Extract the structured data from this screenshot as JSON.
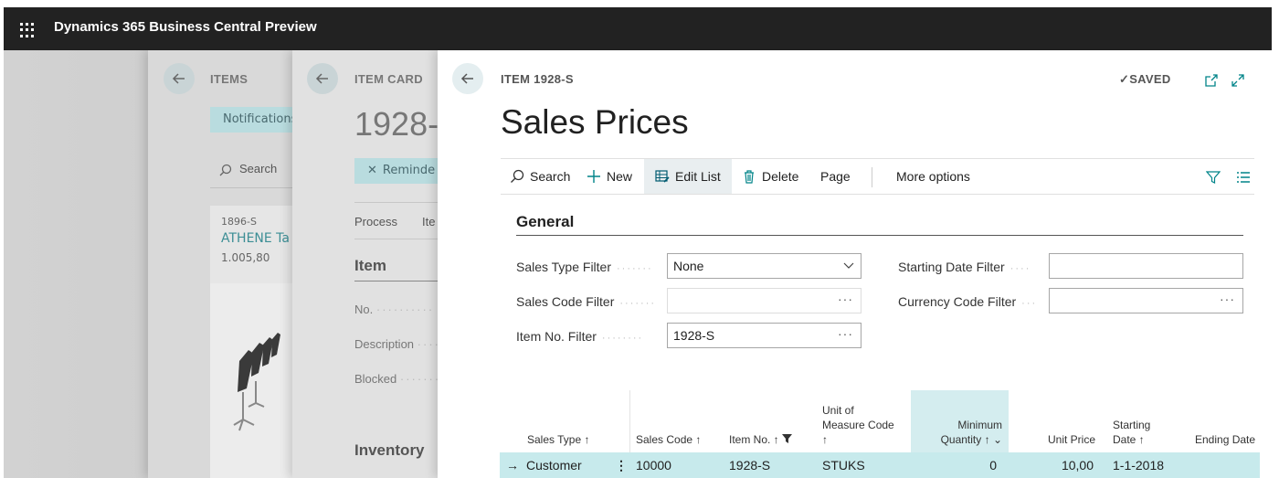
{
  "app": {
    "title": "Dynamics 365 Business Central Preview"
  },
  "panel_items": {
    "crumb": "ITEMS",
    "notifications": "Notifications",
    "search": "Search",
    "card": {
      "no": "1896-S",
      "name": "ATHENE Ta",
      "price": "1.005,80"
    }
  },
  "panel_itemcard": {
    "crumb": "ITEM CARD",
    "title": "1928-",
    "remind": "Reminde",
    "tabs": [
      "Process",
      "Ite"
    ],
    "section": "Item",
    "fields": [
      "No.",
      "Description",
      "Blocked"
    ],
    "section2": "Inventory"
  },
  "panel_main": {
    "crumb": "ITEM 1928-S",
    "saved": "SAVED",
    "title": "Sales Prices",
    "actions": {
      "search": "Search",
      "new": "New",
      "edit_list": "Edit List",
      "delete": "Delete",
      "page": "Page",
      "more": "More options"
    },
    "general": {
      "heading": "General",
      "sales_type_filter": {
        "label": "Sales Type Filter",
        "value": "None"
      },
      "sales_code_filter": {
        "label": "Sales Code Filter",
        "value": ""
      },
      "item_no_filter": {
        "label": "Item No. Filter",
        "value": "1928-S"
      },
      "starting_date_filter": {
        "label": "Starting Date Filter",
        "value": ""
      },
      "currency_code_filter": {
        "label": "Currency Code Filter",
        "value": ""
      }
    },
    "grid": {
      "columns": {
        "sales_type": "Sales Type ↑",
        "sales_code": "Sales Code ↑",
        "item_no": "Item No. ↑",
        "uom_1": "Unit of",
        "uom_2": "Measure Code",
        "uom_3": "↑",
        "minqty_1": "Minimum",
        "minqty_2": "Quantity ↑",
        "unit_price": "Unit Price",
        "start_1": "Starting",
        "start_2": "Date ↑",
        "ending": "Ending Date"
      },
      "rows": [
        {
          "sales_type": "Customer",
          "sales_code": "10000",
          "item_no": "1928-S",
          "uom": "STUKS",
          "min_qty": "0",
          "unit_price": "10,00",
          "starting_date": "1-1-2018",
          "ending_date": ""
        }
      ]
    }
  },
  "colors": {
    "topbar": "#222222",
    "accent": "#008489",
    "row_selected": "#c7eaec"
  }
}
